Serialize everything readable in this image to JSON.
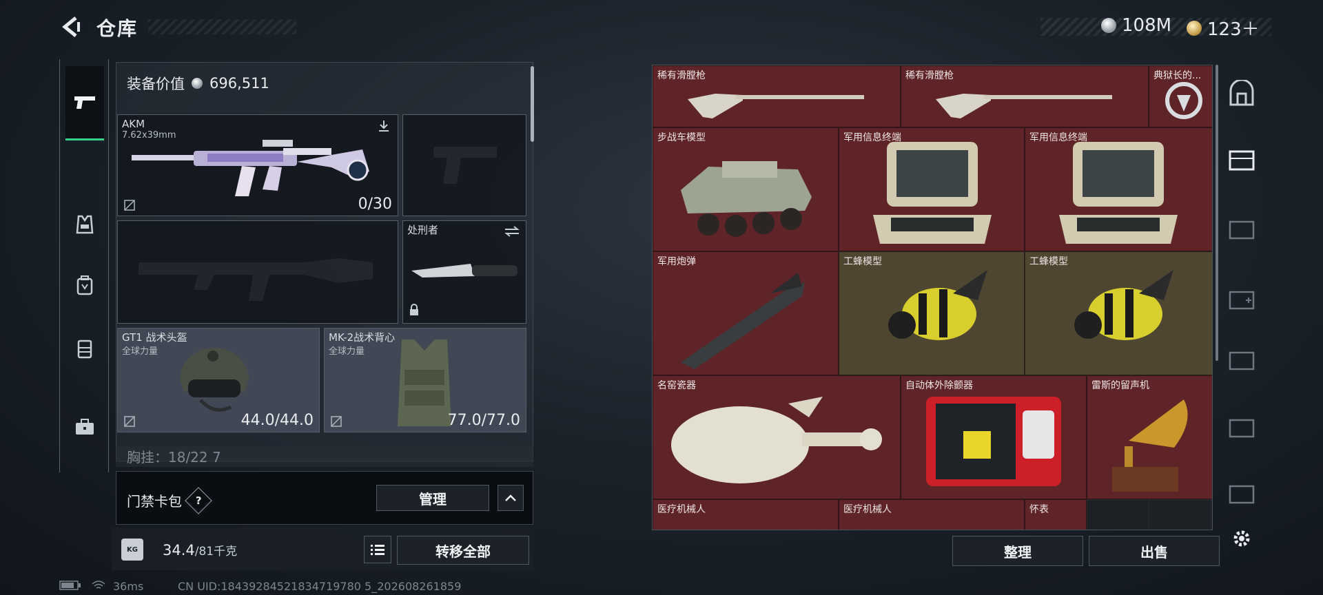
{
  "header": {
    "title": "仓库",
    "currency_silver": "108M",
    "currency_gold": "123＋"
  },
  "equipment": {
    "value_label": "装备价值",
    "value": "696,511",
    "primary": {
      "name": "AKM",
      "caliber": "7.62x39mm",
      "ammo": "0/30"
    },
    "melee": {
      "name": "处刑者"
    },
    "helmet": {
      "name": "GT1 战术头盔",
      "brand": "全球力量",
      "durability": "44.0/44.0"
    },
    "vest": {
      "name": "MK-2战术背心",
      "brand": "全球力量",
      "durability": "77.0/77.0"
    },
    "partial_row": "胸挂：18/22  7"
  },
  "access_card": {
    "label": "门禁卡包",
    "help": "?",
    "manage_label": "管理"
  },
  "bottom": {
    "weight": "34.4",
    "weight_max": "/81千克",
    "weight_icon": "KG",
    "transfer_all_label": "转移全部"
  },
  "status": {
    "ping": "36ms",
    "uid": "CN UID:18439284521834719780 5_202608261859"
  },
  "stash": {
    "items": [
      {
        "label": "稀有滑膛枪"
      },
      {
        "label": "稀有滑膛枪"
      },
      {
        "label": "典狱长的..."
      },
      {
        "label": "步战车模型"
      },
      {
        "label": "军用信息终端"
      },
      {
        "label": "军用信息终端"
      },
      {
        "label": "军用炮弹"
      },
      {
        "label": "工蜂模型"
      },
      {
        "label": "工蜂模型"
      },
      {
        "label": "名窑瓷器"
      },
      {
        "label": "自动体外除颤器"
      },
      {
        "label": "雷斯的留声机"
      },
      {
        "label": "医疗机械人"
      },
      {
        "label": "医疗机械人"
      },
      {
        "label": "怀表"
      }
    ],
    "sort_label": "整理",
    "sell_label": "出售"
  },
  "icons": [
    "back-arrow-icon",
    "pistol-icon",
    "vest-icon",
    "backpack-icon",
    "rig-icon",
    "briefcase-icon",
    "safe-icon",
    "gear-icon",
    "list-icon",
    "lock-icon",
    "swap-icon",
    "download-icon"
  ]
}
